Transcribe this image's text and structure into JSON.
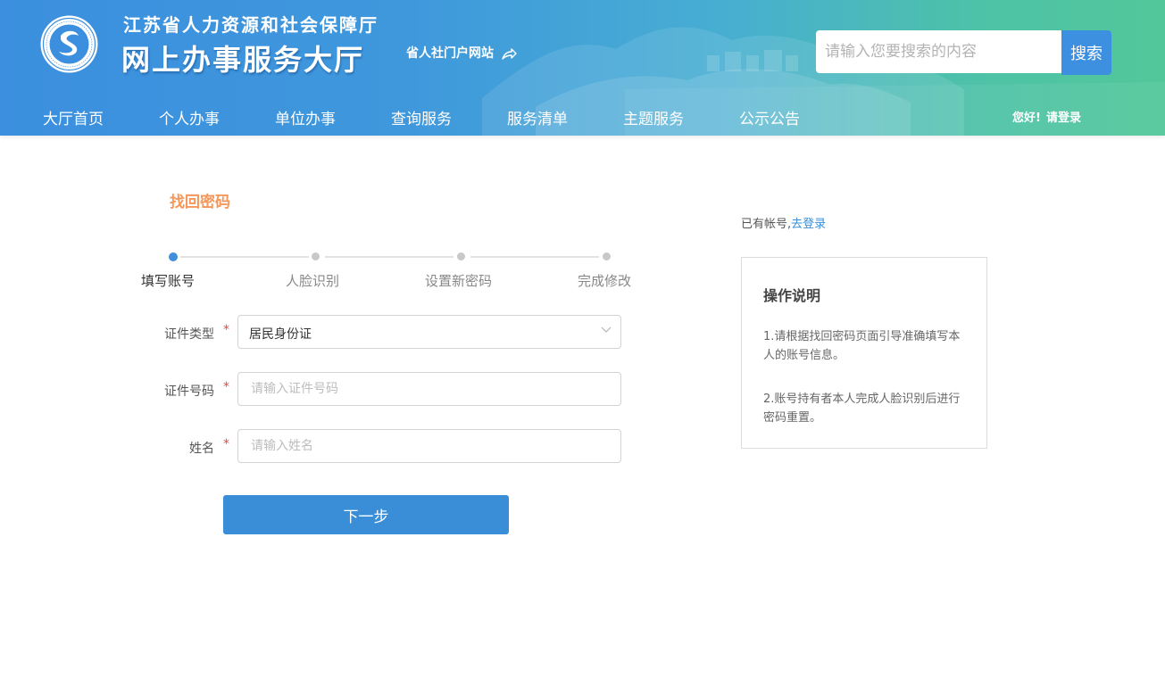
{
  "header": {
    "org_name": "江苏省人力资源和社会保障厅",
    "site_name": "网上办事服务大厅",
    "portal_link": "省人社门户网站",
    "search_placeholder": "请输入您要搜索的内容",
    "search_button": "搜索",
    "nav": [
      "大厅首页",
      "个人办事",
      "单位办事",
      "查询服务",
      "服务清单",
      "主题服务",
      "公示公告"
    ],
    "greeting": "您好!",
    "login": "请登录",
    "logo_text": "江苏省人力资源和社会保障厅"
  },
  "page": {
    "title": "找回密码",
    "steps": [
      {
        "label": "填写账号",
        "active": true
      },
      {
        "label": "人脸识别",
        "active": false
      },
      {
        "label": "设置新密码",
        "active": false
      },
      {
        "label": "完成修改",
        "active": false
      }
    ],
    "form": {
      "id_type_label": "证件类型",
      "id_type_value": "居民身份证",
      "id_number_label": "证件号码",
      "id_number_placeholder": "请输入证件号码",
      "name_label": "姓名",
      "name_placeholder": "请输入姓名",
      "required_mark": "*"
    },
    "next_button": "下一步",
    "have_account": "已有帐号,",
    "go_login": "去登录",
    "help": {
      "title": "操作说明",
      "items": [
        "1.请根据找回密码页面引导准确填写本人的账号信息。",
        "2.账号持有者本人完成人脸识别后进行密码重置。"
      ]
    }
  },
  "colors": {
    "primary": "#3a8ed8",
    "title_accent": "#f5965a",
    "required": "#e5484d"
  }
}
